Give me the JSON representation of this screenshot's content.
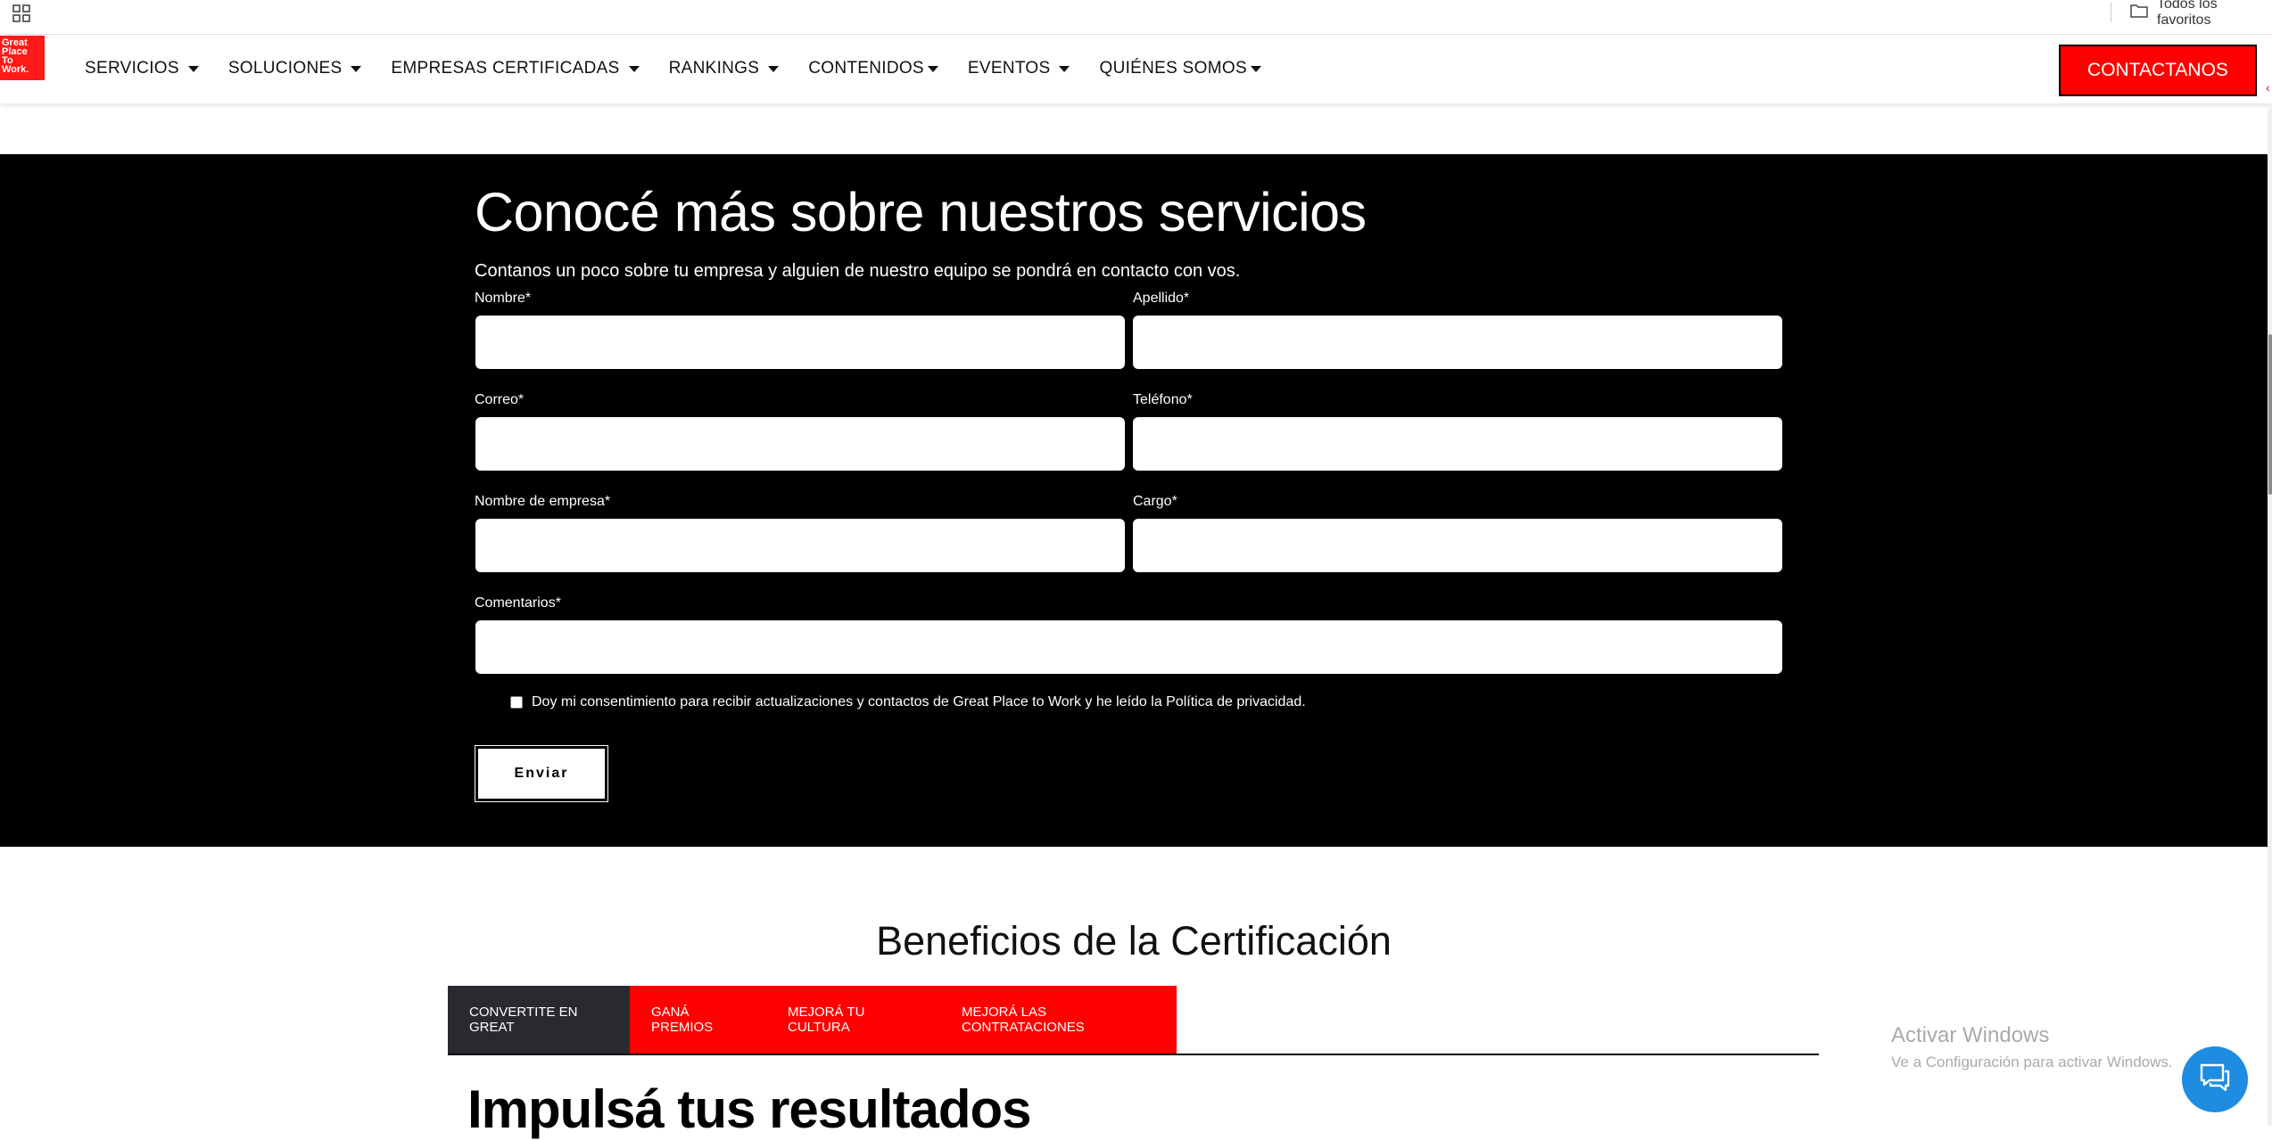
{
  "bookmarks": {
    "favorites_label": "Todos los favoritos"
  },
  "nav": {
    "logo_lines": [
      "Great",
      "Place",
      "To",
      "Work."
    ],
    "items": [
      "SERVICIOS",
      "SOLUCIONES",
      "EMPRESAS CERTIFICADAS",
      "RANKINGS",
      "CONTENIDOS",
      "EVENTOS",
      "QUIÉNES SOMOS"
    ],
    "contact_label": "CONTACTANOS"
  },
  "form": {
    "heading": "Conocé más sobre nuestros servicios",
    "subheading": "Contanos un poco sobre tu empresa y alguien de nuestro equipo se pondrá en contacto con vos.",
    "fields": {
      "nombre": "Nombre*",
      "apellido": "Apellido*",
      "correo": "Correo*",
      "telefono": "Teléfono*",
      "empresa": "Nombre de empresa*",
      "cargo": "Cargo*",
      "comentarios": "Comentarios*"
    },
    "consent": "Doy mi consentimiento para recibir actualizaciones y contactos de Great Place to Work y he leído la Política de privacidad.",
    "submit_label": "Enviar"
  },
  "benefits": {
    "title": "Beneficios de la Certificación",
    "tabs": [
      "CONVERTITE EN GREAT",
      "GANÁ PREMIOS",
      "MEJORÁ TU CULTURA",
      "MEJORÁ LAS CONTRATACIONES"
    ],
    "active_tab": "CONVERTITE EN GREAT",
    "content_heading": "Impulsá tus resultados"
  },
  "windows": {
    "title": "Activar Windows",
    "subtitle": "Ve a Configuración para activar Windows."
  },
  "colors": {
    "brand_red": "#ff0000",
    "dark_tab": "#282a30",
    "chat_blue": "#1e8ce0"
  },
  "icons": {
    "apps": "grid-icon",
    "favorites": "folder-icon",
    "chat": "chat-icon"
  }
}
